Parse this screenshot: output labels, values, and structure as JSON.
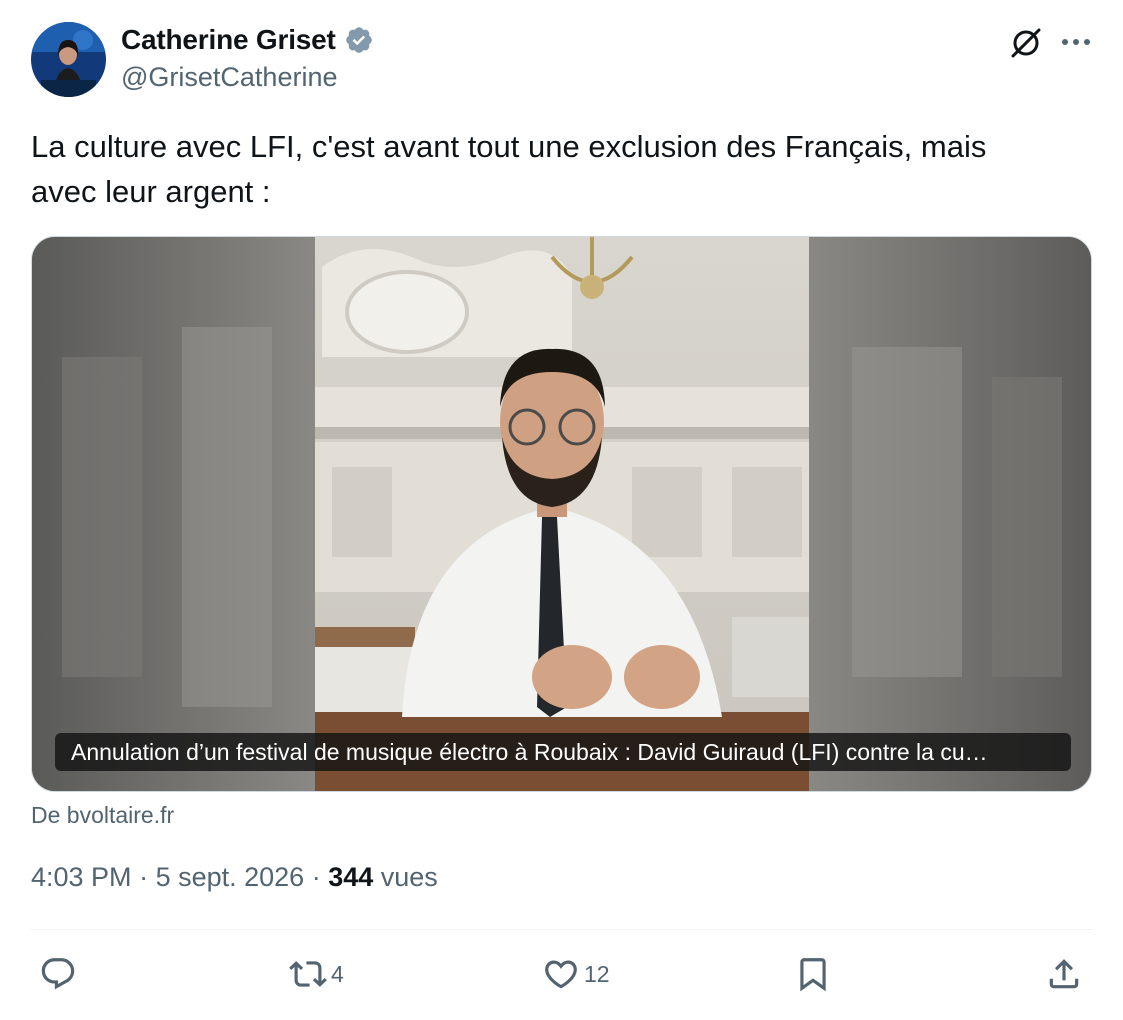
{
  "author": {
    "display_name": "Catherine Griset",
    "handle": "@GrisetCatherine",
    "verified": true
  },
  "tweet": {
    "text": "La culture avec LFI, c'est avant tout une exclusion des Français, mais\navec leur argent :"
  },
  "media": {
    "caption": "Annulation d’un festival de musique électro à Roubaix : David Guiraud (LFI) contre la cu…",
    "source": "De bvoltaire.fr"
  },
  "meta": {
    "time": "4:03 PM",
    "separator": " · ",
    "date": "5 sept. 2026",
    "views_count": "344",
    "views_label": " vues"
  },
  "actions": {
    "reply_count": "",
    "retweet_count": "4",
    "like_count": "12"
  },
  "colors": {
    "secondary_text": "#536471",
    "verified_badge": "#829aab",
    "divider": "#eff3f4"
  },
  "icons": [
    "verified-badge-icon",
    "grok-icon",
    "more-icon",
    "reply-icon",
    "retweet-icon",
    "like-icon",
    "bookmark-icon",
    "share-icon"
  ]
}
